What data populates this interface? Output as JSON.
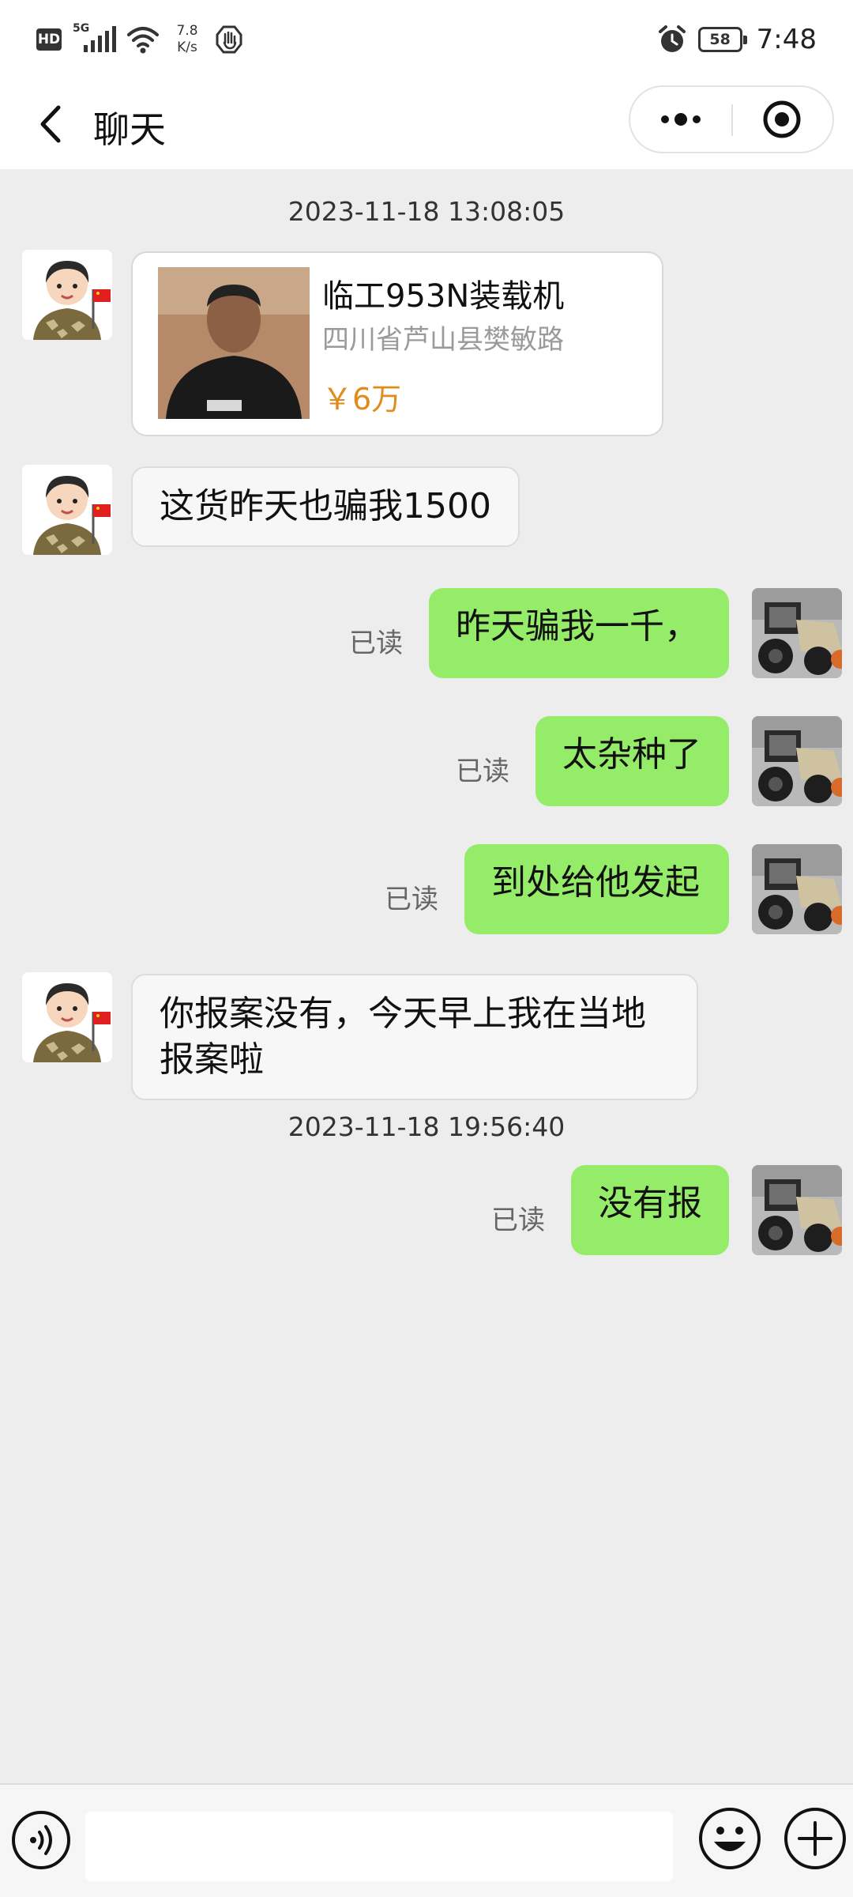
{
  "status_bar": {
    "hd": "HD",
    "network_type": "5G",
    "net_speed_value": "7.8",
    "net_speed_unit": "K/s",
    "battery": "58",
    "time": "7:48"
  },
  "header": {
    "title": "聊天"
  },
  "messages": {
    "timestamp_1": "2023-11-18 13:08:05",
    "product": {
      "title": "临工953N装载机",
      "location": "四川省芦山县樊敏路",
      "price": "￥6万"
    },
    "msg_1": "这货昨天也骗我1500",
    "msg_2": "昨天骗我一千，",
    "msg_3": "太杂种了",
    "msg_4": "到处给他发起",
    "msg_5_line1": "你报案没有，今天早上我在当地",
    "msg_5_line2": "报案啦",
    "timestamp_2": "2023-11-18 19:56:40",
    "msg_6": "没有报",
    "read_label": "已读"
  },
  "input": {
    "value": "",
    "placeholder": ""
  },
  "colors": {
    "sent_bubble": "#95ec69",
    "background": "#ededed",
    "price": "#e28a1c"
  },
  "icons": {
    "back": "chevron-left-icon",
    "more": "more-dots-icon",
    "close": "target-circle-icon",
    "voice": "voice-icon",
    "emoji": "emoji-icon",
    "plus": "plus-circle-icon"
  }
}
